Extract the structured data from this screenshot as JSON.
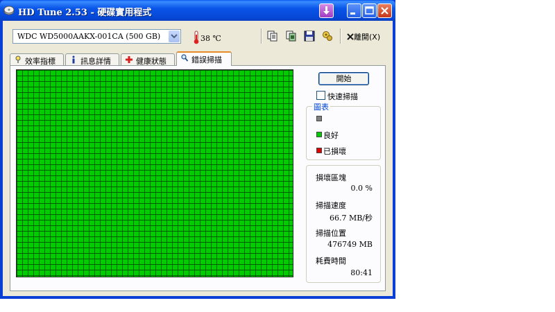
{
  "window": {
    "title": "HD Tune 2.53 - 硬碟實用程式"
  },
  "toolbar": {
    "drive": "WDC WD5000AAKX-001CA (500 GB)",
    "temperature": "38 ℃",
    "exit_label": "離開(X)",
    "icons": [
      "copy-text-icon",
      "copy-screenshot-icon",
      "save-icon",
      "options-icon"
    ]
  },
  "tabs": [
    {
      "label": "效率指標",
      "icon": "benchmark-icon",
      "active": false
    },
    {
      "label": "訊息詳情",
      "icon": "info-icon",
      "active": false
    },
    {
      "label": "健康狀態",
      "icon": "health-cross-icon",
      "active": false
    },
    {
      "label": "錯誤掃描",
      "icon": "magnifier-icon",
      "active": true
    }
  ],
  "scan": {
    "start_label": "開始",
    "quick_scan_label": "快速掃描",
    "quick_scan_checked": false,
    "block_state": "good",
    "grid_color": "#00cc00"
  },
  "legend": {
    "title": "圖表",
    "items": [
      {
        "label": "",
        "color": "#808080"
      },
      {
        "label": "良好",
        "color": "#00cc00"
      },
      {
        "label": "已損壞",
        "color": "#e00000"
      }
    ]
  },
  "stats": {
    "damaged_blocks_label": "損壞區塊",
    "damaged_blocks_value": "0.0 %",
    "scan_speed_label": "掃描速度",
    "scan_speed_value": "66.7 MB/秒",
    "scan_position_label": "掃描位置",
    "scan_position_value": "476749 MB",
    "elapsed_label": "耗費時間",
    "elapsed_value": "80:41"
  }
}
